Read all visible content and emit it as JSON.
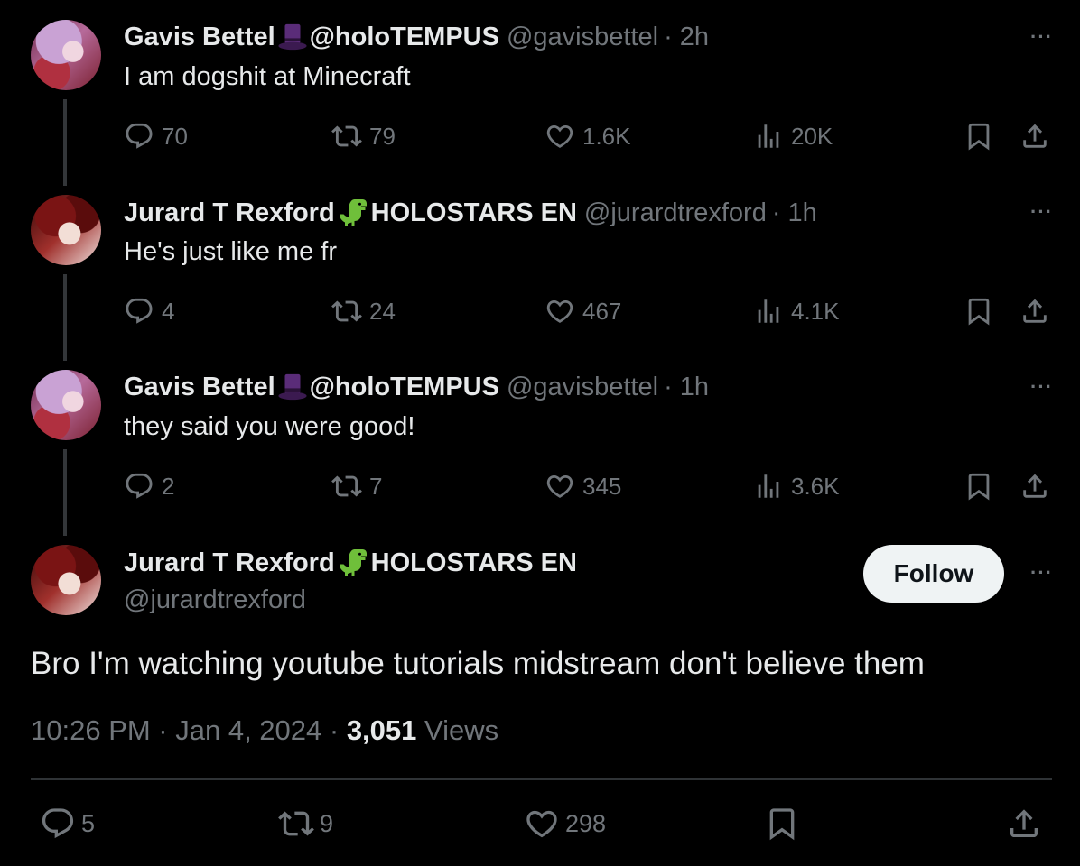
{
  "tweets": [
    {
      "name": "Gavis Bettel",
      "emoji": "top-hat-emoji",
      "name_suffix": "@holoTEMPUS",
      "handle": "@gavisbettel",
      "time": "· 2h",
      "text": "I am dogshit at Minecraft",
      "replies": "70",
      "reposts": "79",
      "likes": "1.6K",
      "views": "20K"
    },
    {
      "name": "Jurard T Rexford",
      "emoji": "t-rex-emoji",
      "name_suffix": "HOLOSTARS EN",
      "handle": "@jurardtrexford",
      "time": "· 1h",
      "text": "He's just like me fr",
      "replies": "4",
      "reposts": "24",
      "likes": "467",
      "views": "4.1K"
    },
    {
      "name": "Gavis Bettel",
      "emoji": "top-hat-emoji",
      "name_suffix": "@holoTEMPUS",
      "handle": "@gavisbettel",
      "time": "· 1h",
      "text": "they said you were good!",
      "replies": "2",
      "reposts": "7",
      "likes": "345",
      "views": "3.6K"
    }
  ],
  "main": {
    "name": "Jurard T Rexford",
    "emoji": "t-rex-emoji",
    "name_suffix": "HOLOSTARS EN",
    "handle": "@jurardtrexford",
    "follow_label": "Follow",
    "text": "Bro I'm watching youtube tutorials midstream don't believe them",
    "timestamp": "10:26 PM · Jan 4, 2024 · ",
    "views_count": "3,051",
    "views_label": " Views",
    "replies": "5",
    "reposts": "9",
    "likes": "298"
  },
  "more_label": "···",
  "colors": {
    "background": "#000000",
    "text": "#e7e9ea",
    "muted": "#71767b",
    "follow_bg": "#eff3f4"
  }
}
